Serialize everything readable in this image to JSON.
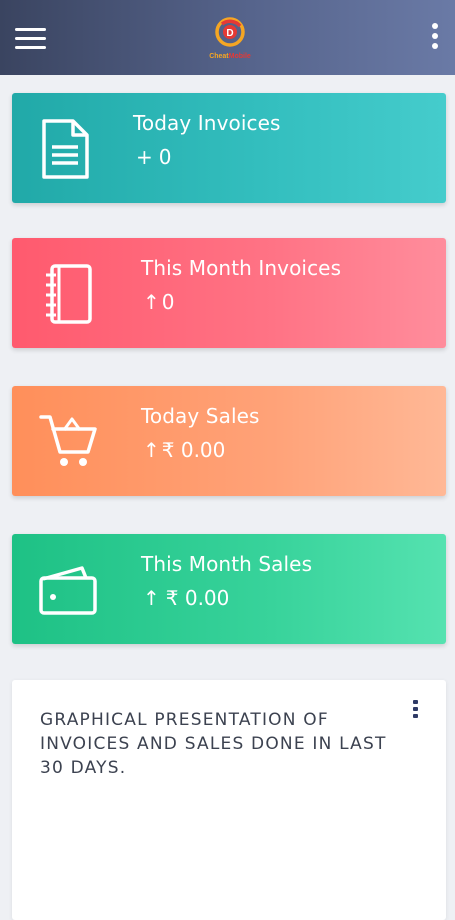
{
  "app": {
    "logo_text_1": "Cheat",
    "logo_text_2": "Mobile",
    "brand_colors": {
      "primary": "#f5a623",
      "secondary": "#e53935"
    },
    "header_gradient": [
      "#3a4460",
      "#6a7aa6"
    ]
  },
  "icons": {
    "menu": "hamburger-icon",
    "more": "more-vertical-icon"
  },
  "cards": [
    {
      "title": "Today Invoices",
      "arrow": "+",
      "value": "0",
      "icon": "document-icon",
      "colors": [
        "#21a9a8",
        "#45cccc"
      ]
    },
    {
      "title": "This Month Invoices",
      "arrow": "↑",
      "value": "0",
      "icon": "notebook-icon",
      "colors": [
        "#ff5a6e",
        "#ff8d9c"
      ]
    },
    {
      "title": "Today Sales",
      "arrow": "↑",
      "value": "₹ 0.00",
      "icon": "cart-icon",
      "colors": [
        "#ff8f5a",
        "#ffb896"
      ]
    },
    {
      "title": "This Month Sales",
      "arrow": "↑",
      "value": "₹ 0.00",
      "icon": "wallet-icon",
      "colors": [
        "#1ec185",
        "#55e2b0"
      ]
    }
  ],
  "panel": {
    "title": "GRAPHICAL PRESENTATION OF INVOICES AND SALES DONE IN LAST 30 DAYS."
  }
}
